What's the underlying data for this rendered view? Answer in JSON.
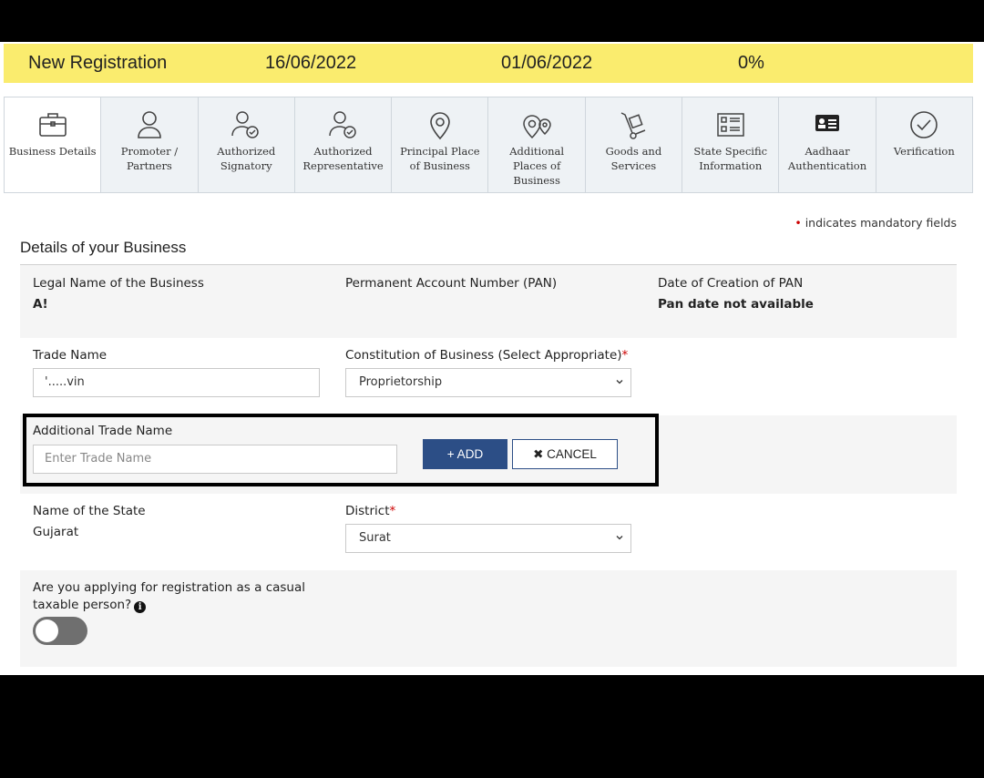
{
  "status_bar": {
    "title": "New Registration",
    "date_1": "16/06/2022",
    "date_2": "01/06/2022",
    "progress": "0%"
  },
  "tabs": [
    {
      "label": "Business Details",
      "icon": "briefcase-icon",
      "active": true
    },
    {
      "label": "Promoter / Partners",
      "icon": "person-icon"
    },
    {
      "label": "Authorized Signatory",
      "icon": "person-check-icon"
    },
    {
      "label": "Authorized Representative",
      "icon": "person-check-icon"
    },
    {
      "label": "Principal Place of Business",
      "icon": "location-pin-icon"
    },
    {
      "label": "Additional Places of Business",
      "icon": "double-location-pin-icon"
    },
    {
      "label": "Goods and Services",
      "icon": "hand-truck-icon"
    },
    {
      "label": "State Specific Information",
      "icon": "list-icon"
    },
    {
      "label": "Aadhaar Authentication",
      "icon": "id-card-icon"
    },
    {
      "label": "Verification",
      "icon": "check-circle-icon"
    }
  ],
  "mandatory_note": "indicates mandatory fields",
  "section_title": "Details of your Business",
  "legal_name": {
    "label": "Legal Name of the Business",
    "value": "A!"
  },
  "pan": {
    "label": "Permanent Account Number (PAN)"
  },
  "pan_date": {
    "label": "Date of Creation of PAN",
    "value": "Pan date not available"
  },
  "trade_name": {
    "label": "Trade Name",
    "value": "'.....vin"
  },
  "constitution": {
    "label": "Constitution of Business (Select Appropriate)",
    "value": "Proprietorship"
  },
  "additional_trade_name": {
    "label": "Additional Trade Name",
    "placeholder": "Enter Trade Name",
    "add_label": "+ ADD",
    "cancel_label": "✖ CANCEL"
  },
  "state": {
    "label": "Name of the State",
    "value": "Gujarat"
  },
  "district": {
    "label": "District",
    "value": "Surat"
  },
  "casual": {
    "line1": "Are you applying for registration as a casual",
    "line2": "taxable person?",
    "toggle_on": false
  }
}
